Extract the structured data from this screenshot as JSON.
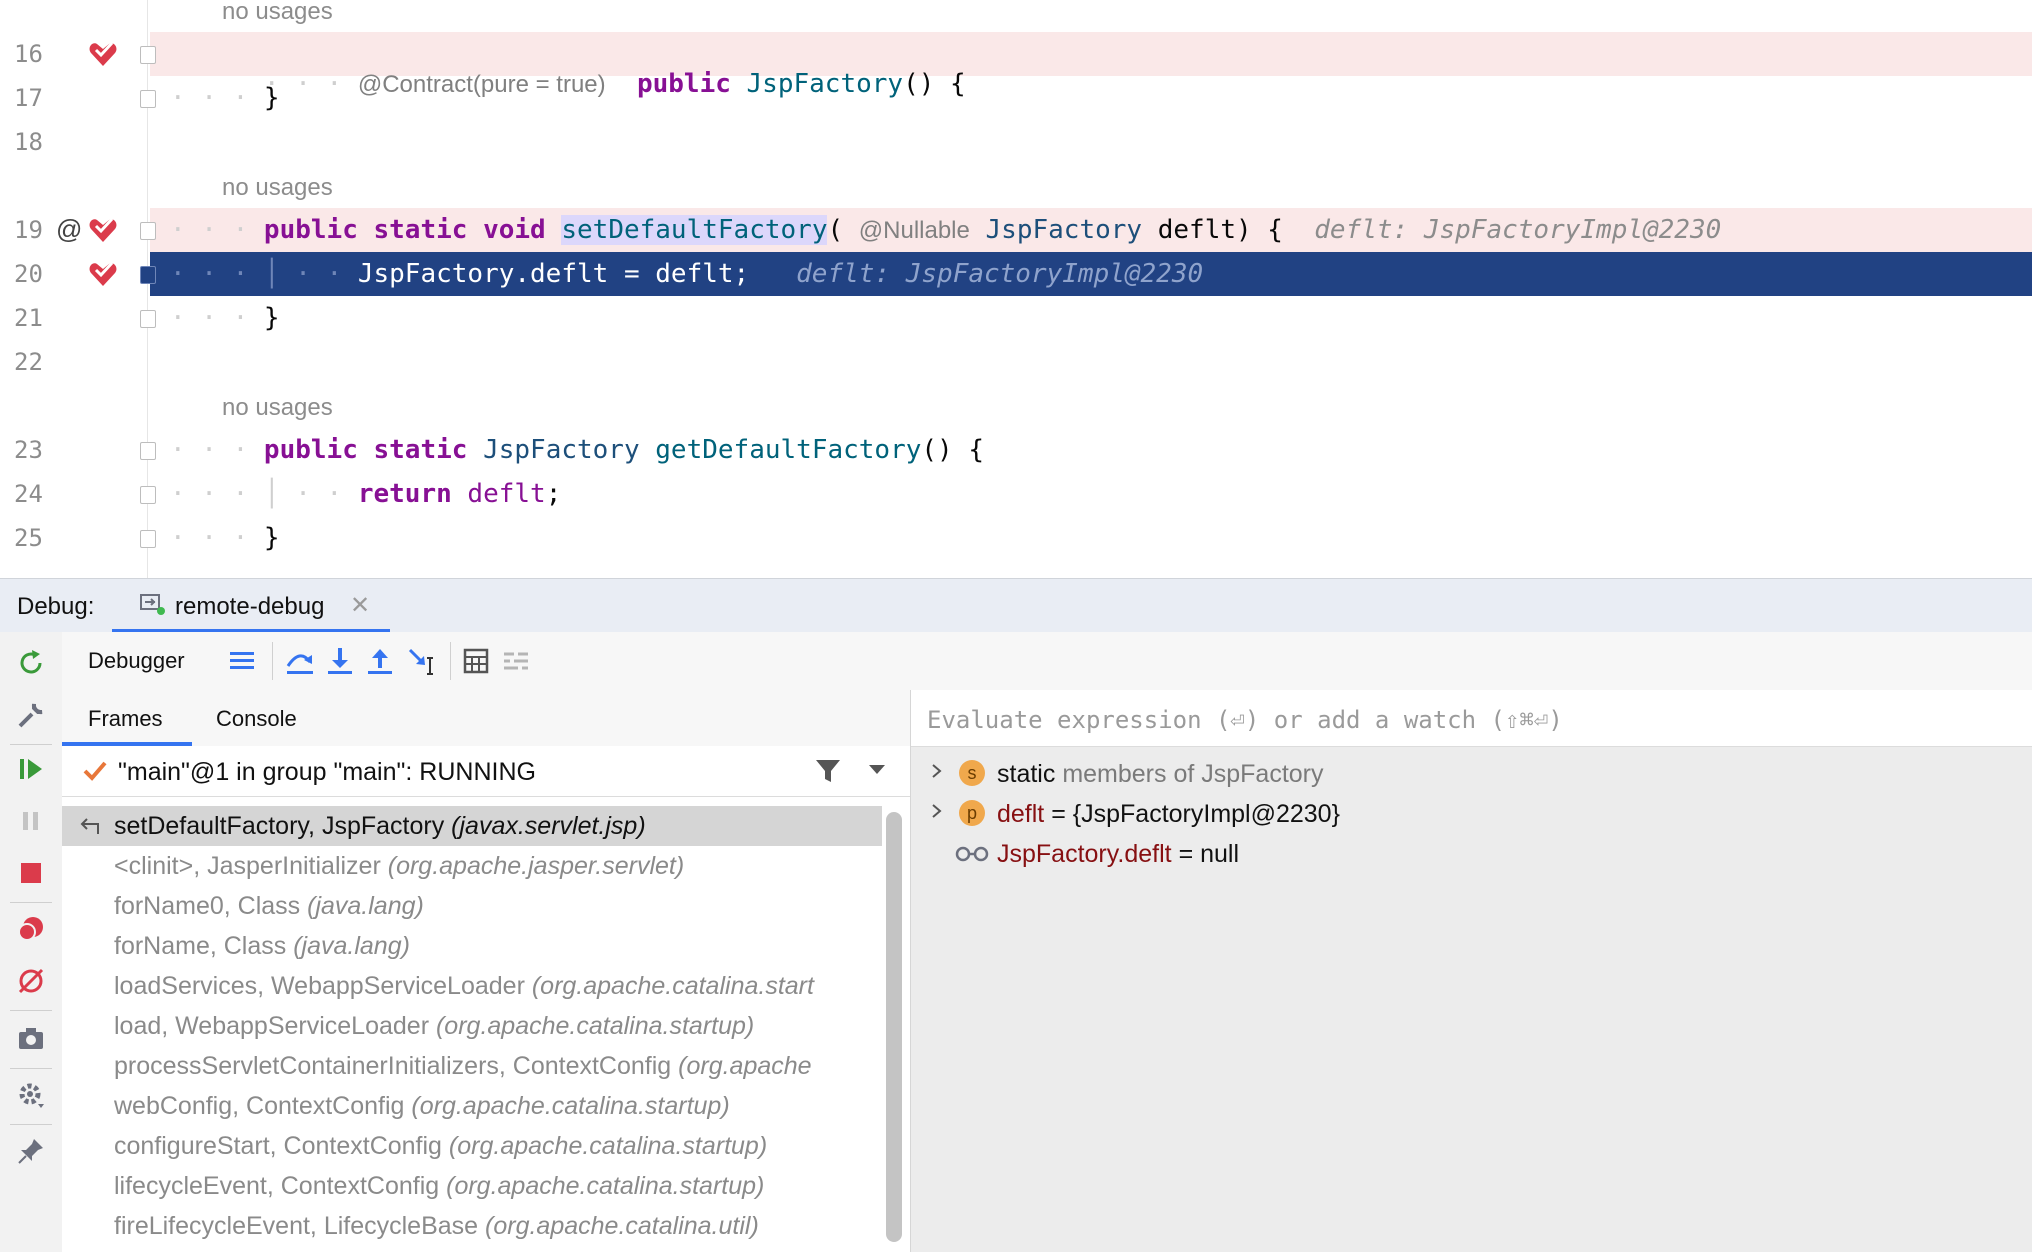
{
  "editor": {
    "lines": [
      {
        "num": "16",
        "usage": "no usages",
        "hint": "@Contract(pure = true)",
        "kw1": "public",
        "name": "JspFactory",
        "rest": "() {"
      },
      {
        "num": "17",
        "code": "}"
      },
      {
        "num": "18"
      },
      {
        "num": "19",
        "usage": "no usages",
        "kw1": "public",
        "kw2": "static",
        "kw3": "void",
        "name": "setDefaultFactory",
        "paren": "(",
        "annot": "@Nullable",
        "type": "JspFactory",
        "param": "deflt) {",
        "inline": "deflt: JspFactoryImpl@2230"
      },
      {
        "num": "20",
        "code": "JspFactory.deflt = deflt;",
        "inline": "deflt: JspFactoryImpl@2230"
      },
      {
        "num": "21",
        "code": "}"
      },
      {
        "num": "22"
      },
      {
        "num": "23",
        "usage": "no usages",
        "kw1": "public",
        "kw2": "static",
        "type": "JspFactory",
        "name": "getDefaultFactory",
        "rest": "() {"
      },
      {
        "num": "24",
        "kw1": "return",
        "var": "deflt",
        "rest": ";"
      },
      {
        "num": "25",
        "code": "}"
      }
    ],
    "gutter_at": "@"
  },
  "debug": {
    "label": "Debug:",
    "session_tab": "remote-debug",
    "toolbar_label": "Debugger",
    "tabs": [
      "Frames",
      "Console"
    ],
    "thread": "\"main\"@1 in group \"main\": RUNNING",
    "frames": [
      {
        "method": "setDefaultFactory, JspFactory",
        "pkg": "(javax.servlet.jsp)"
      },
      {
        "method": "<clinit>, JasperInitializer",
        "pkg": "(org.apache.jasper.servlet)"
      },
      {
        "method": "forName0, Class",
        "pkg": "(java.lang)"
      },
      {
        "method": "forName, Class",
        "pkg": "(java.lang)"
      },
      {
        "method": "loadServices, WebappServiceLoader",
        "pkg": "(org.apache.catalina.start"
      },
      {
        "method": "load, WebappServiceLoader",
        "pkg": "(org.apache.catalina.startup)"
      },
      {
        "method": "processServletContainerInitializers, ContextConfig",
        "pkg": "(org.apache"
      },
      {
        "method": "webConfig, ContextConfig",
        "pkg": "(org.apache.catalina.startup)"
      },
      {
        "method": "configureStart, ContextConfig",
        "pkg": "(org.apache.catalina.startup)"
      },
      {
        "method": "lifecycleEvent, ContextConfig",
        "pkg": "(org.apache.catalina.startup)"
      },
      {
        "method": "fireLifecycleEvent, LifecycleBase",
        "pkg": "(org.apache.catalina.util)"
      }
    ],
    "eval_placeholder": "Evaluate expression (⏎) or add a watch (⇧⌘⏎)",
    "variables": [
      {
        "badge": "s",
        "prefix": "static",
        "text": "members of JspFactory"
      },
      {
        "badge": "p",
        "name": "deflt",
        "text": "= {JspFactoryImpl@2230}"
      },
      {
        "name": "JspFactory.deflt",
        "text": "= null"
      }
    ]
  },
  "colors": {
    "selection": "#214283",
    "breakpoint_line": "#fae8e8",
    "accent": "#3574f0"
  }
}
